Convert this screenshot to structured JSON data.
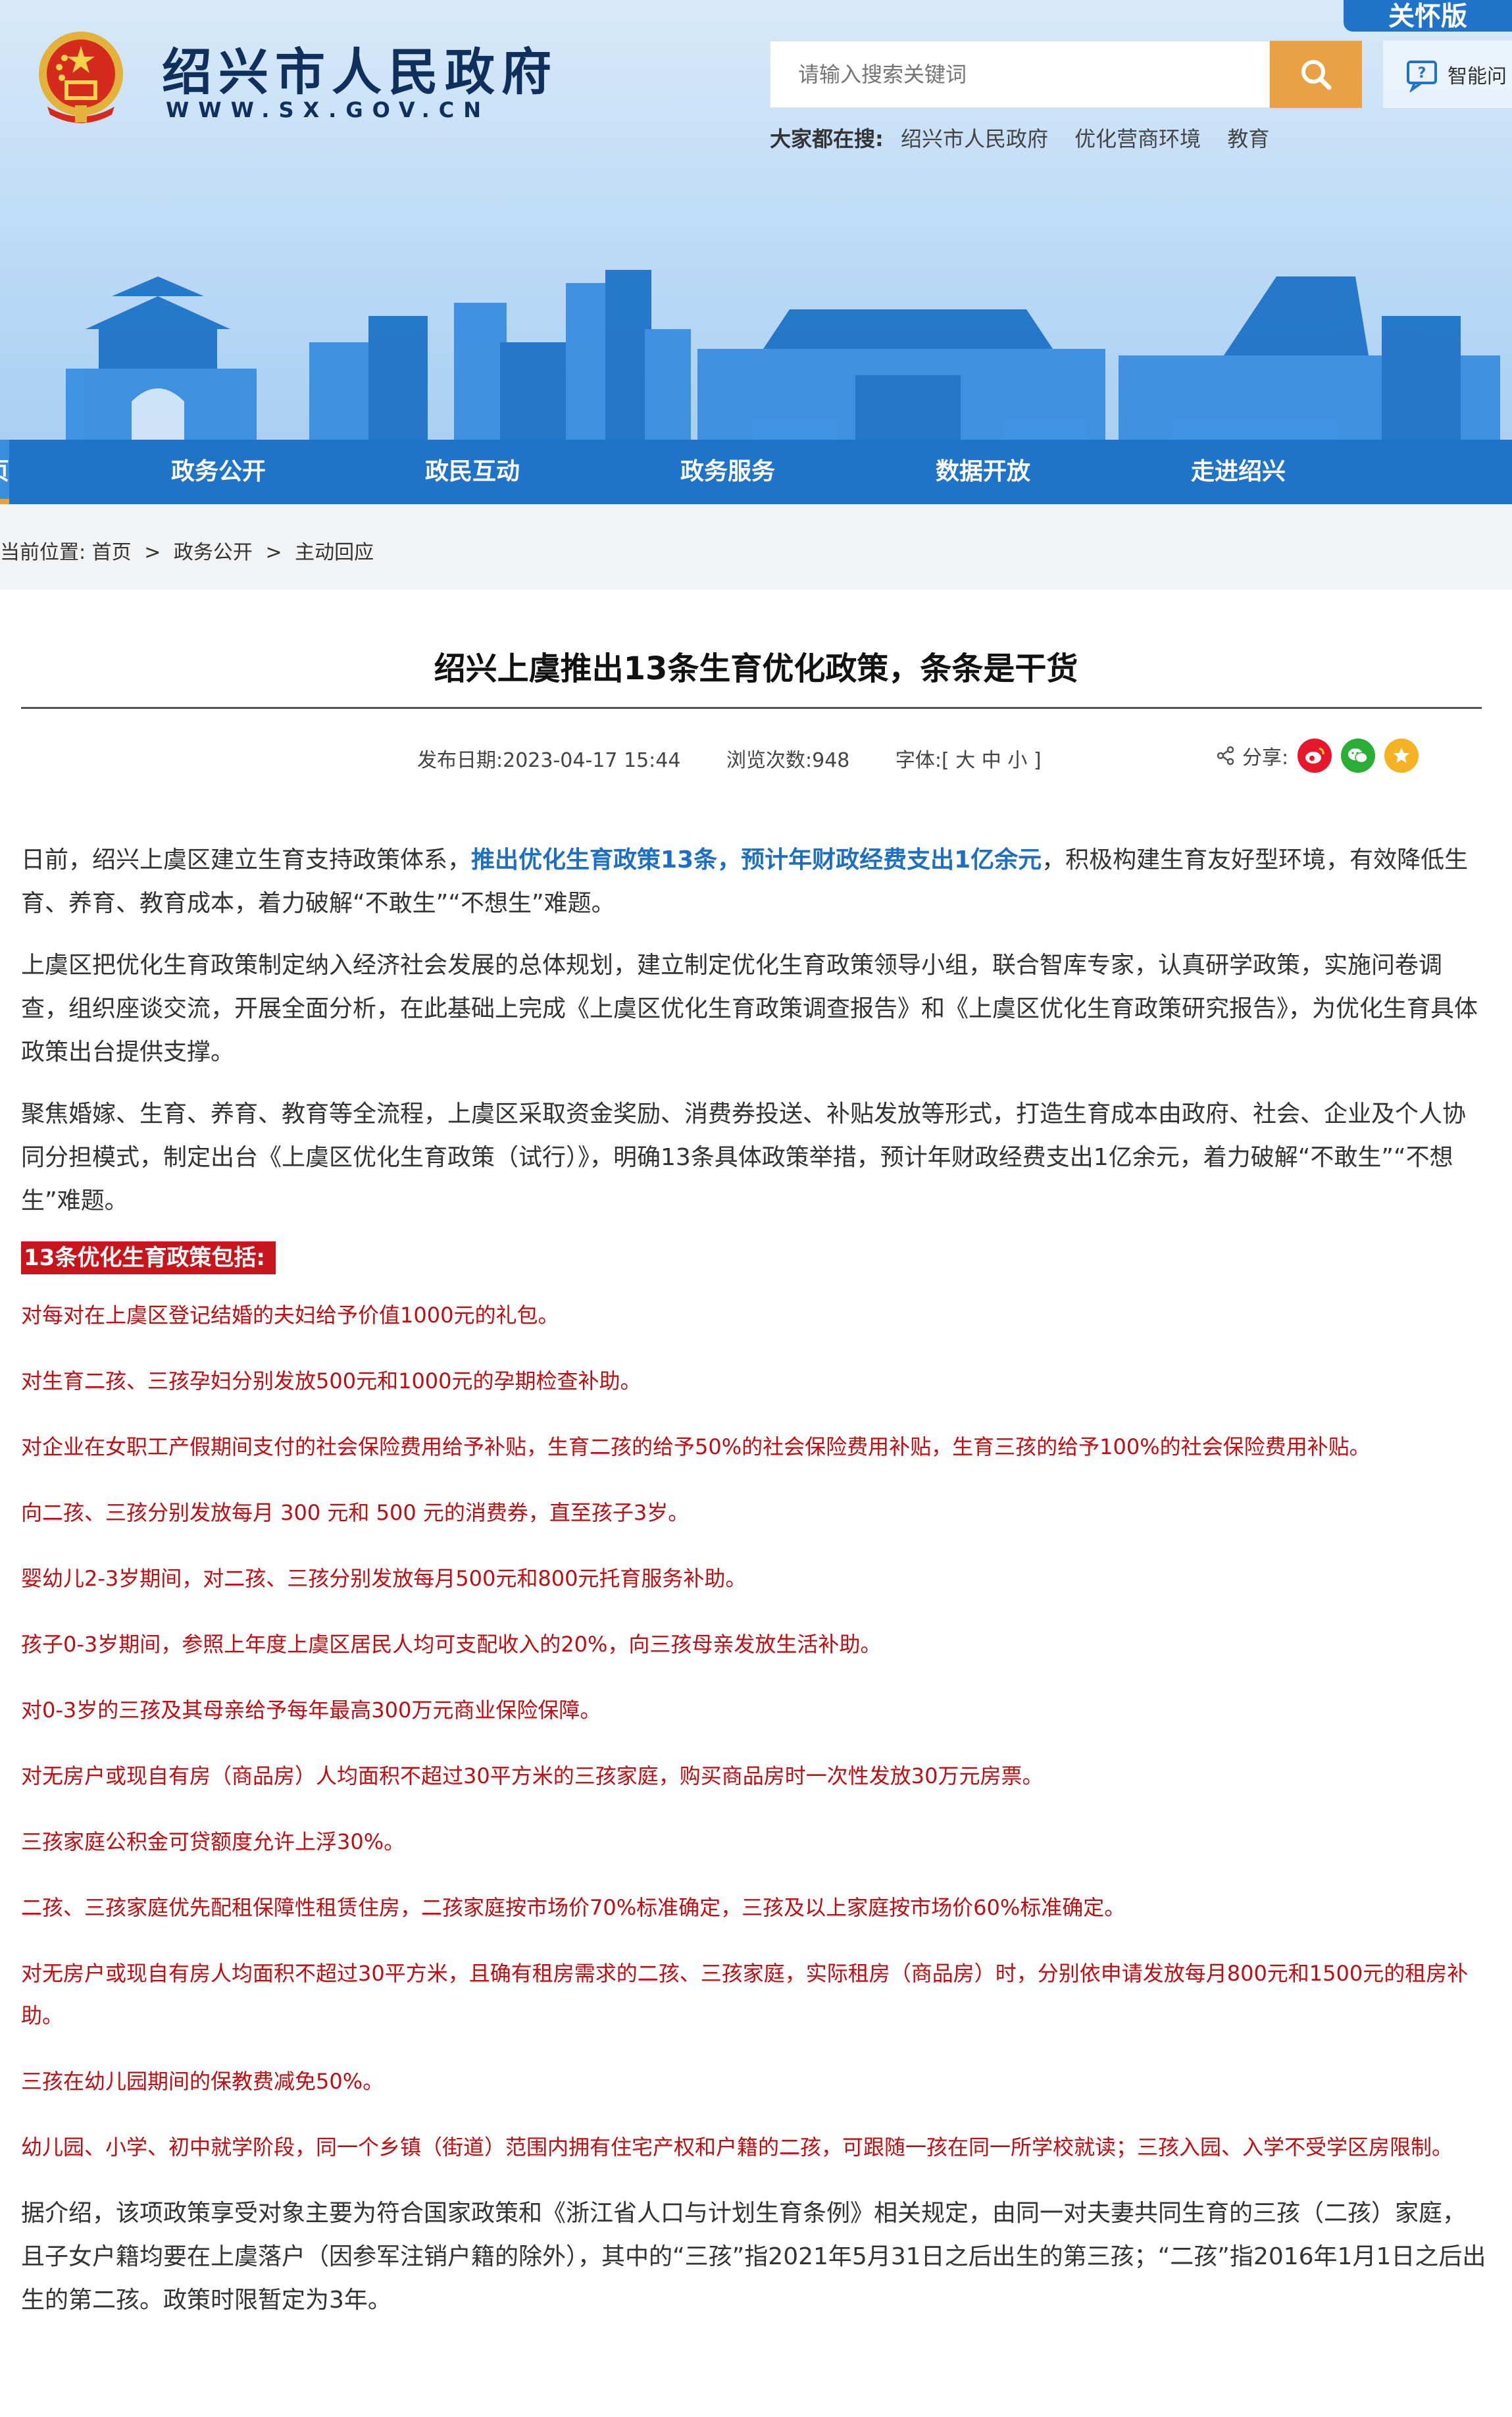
{
  "header": {
    "care_mode": "关怀版",
    "site_title": "绍兴市人民政府",
    "site_url": "WWW.SX.GOV.CN",
    "search_placeholder": "请输入搜索关键词",
    "ai_label": "智能问",
    "hot_label": "大家都在搜:",
    "hot_terms": [
      "绍兴市人民政府",
      "优化营商环境",
      "教育"
    ]
  },
  "nav": {
    "home_fragment": "页",
    "items": [
      "政务公开",
      "政民互动",
      "政务服务",
      "数据开放",
      "走进绍兴"
    ]
  },
  "breadcrumb": {
    "prefix": "当前位置:",
    "items": [
      "首页",
      "政务公开",
      "主动回应"
    ],
    "separator": ">"
  },
  "article": {
    "title": "绍兴上虞推出13条生育优化政策，条条是干货",
    "publish_label": "发布日期:",
    "publish_date": "2023-04-17 15:44",
    "views_label": "浏览次数:",
    "views": "948",
    "font_label": "字体:[ 大 中 小 ]",
    "share_label": "分享:",
    "intro_before": "日前，绍兴上虞区建立生育支持政策体系，",
    "intro_highlight": "推出优化生育政策13条，预计年财政经费支出1亿余元",
    "intro_after": "，积极构建生育友好型环境，有效降低生育、养育、教育成本，着力破解“不敢生”“不想生”难题。",
    "para2": "上虞区把优化生育政策制定纳入经济社会发展的总体规划，建立制定优化生育政策领导小组，联合智库专家，认真研学政策，实施问卷调查，组织座谈交流，开展全面分析，在此基础上完成《上虞区优化生育政策调查报告》和《上虞区优化生育政策研究报告》，为优化生育具体政策出台提供支撑。",
    "para3": "聚焦婚嫁、生育、养育、教育等全流程，上虞区采取资金奖励、消费券投送、补贴发放等形式，打造生育成本由政府、社会、企业及个人协同分担模式，制定出台《上虞区优化生育政策（试行）》，明确13条具体政策举措，预计年财政经费支出1亿余元，着力破解“不敢生”“不想生”难题。",
    "policy_heading": "13条优化生育政策包括:",
    "policies": [
      "对每对在上虞区登记结婚的夫妇给予价值1000元的礼包。",
      "对生育二孩、三孩孕妇分别发放500元和1000元的孕期检查补助。",
      "对企业在女职工产假期间支付的社会保险费用给予补贴，生育二孩的给予50%的社会保险费用补贴，生育三孩的给予100%的社会保险费用补贴。",
      "向二孩、三孩分别发放每月 300 元和 500 元的消费券，直至孩子3岁。",
      "婴幼儿2-3岁期间，对二孩、三孩分别发放每月500元和800元托育服务补助。",
      "孩子0-3岁期间，参照上年度上虞区居民人均可支配收入的20%，向三孩母亲发放生活补助。",
      "对0-3岁的三孩及其母亲给予每年最高300万元商业保险保障。",
      "对无房户或现自有房（商品房）人均面积不超过30平方米的三孩家庭，购买商品房时一次性发放30万元房票。",
      "三孩家庭公积金可贷额度允许上浮30%。",
      "二孩、三孩家庭优先配租保障性租赁住房，二孩家庭按市场价70%标准确定，三孩及以上家庭按市场价60%标准确定。",
      "对无房户或现自有房人均面积不超过30平方米，且确有租房需求的二孩、三孩家庭，实际租房（商品房）时，分别依申请发放每月800元和1500元的租房补助。",
      "三孩在幼儿园期间的保教费减免50%。",
      "幼儿园、小学、初中就学阶段，同一个乡镇（街道）范围内拥有住宅产权和户籍的二孩，可跟随一孩在同一所学校就读；三孩入园、入学不受学区房限制。"
    ],
    "closing": "据介绍，该项政策享受对象主要为符合国家政策和《浙江省人口与计划生育条例》相关规定，由同一对夫妻共同生育的三孩（二孩）家庭，且子女户籍均要在上虞落户（因参军注销户籍的除外），其中的“三孩”指2021年5月31日之后出生的第三孩；“二孩”指2016年1月1日之后出生的第二孩。政策时限暂定为3年。"
  },
  "colors": {
    "nav_blue": "#1f73c8",
    "search_orange": "#e9a143",
    "policy_red": "#c00d12",
    "highlight_blue": "#1d6fc4"
  }
}
